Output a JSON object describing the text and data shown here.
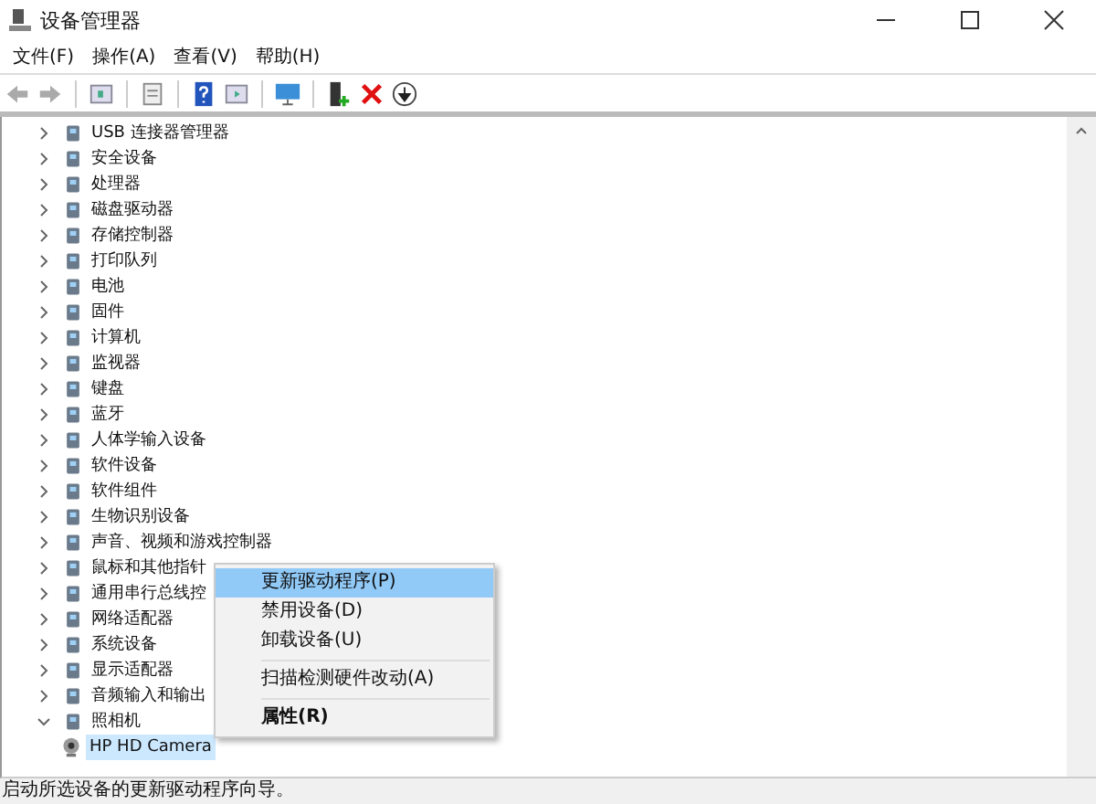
{
  "window": {
    "title": "设备管理器"
  },
  "menu": [
    "文件(F)",
    "操作(A)",
    "查看(V)",
    "帮助(H)"
  ],
  "tree": [
    {
      "label": "USB 连接器管理器",
      "expanded": false,
      "selected": false
    },
    {
      "label": "安全设备",
      "expanded": false,
      "selected": false
    },
    {
      "label": "处理器",
      "expanded": false,
      "selected": false
    },
    {
      "label": "磁盘驱动器",
      "expanded": false,
      "selected": false
    },
    {
      "label": "存储控制器",
      "expanded": false,
      "selected": false
    },
    {
      "label": "打印队列",
      "expanded": false,
      "selected": false
    },
    {
      "label": "电池",
      "expanded": false,
      "selected": false
    },
    {
      "label": "固件",
      "expanded": false,
      "selected": false
    },
    {
      "label": "计算机",
      "expanded": false,
      "selected": false
    },
    {
      "label": "监视器",
      "expanded": false,
      "selected": false
    },
    {
      "label": "键盘",
      "expanded": false,
      "selected": false
    },
    {
      "label": "蓝牙",
      "expanded": false,
      "selected": false
    },
    {
      "label": "人体学输入设备",
      "expanded": false,
      "selected": false
    },
    {
      "label": "软件设备",
      "expanded": false,
      "selected": false
    },
    {
      "label": "软件组件",
      "expanded": false,
      "selected": false
    },
    {
      "label": "生物识别设备",
      "expanded": false,
      "selected": false
    },
    {
      "label": "声音、视频和游戏控制器",
      "expanded": false,
      "selected": false
    },
    {
      "label": "鼠标和其他指针",
      "expanded": false,
      "selected": false
    },
    {
      "label": "通用串行总线控",
      "expanded": false,
      "selected": false
    },
    {
      "label": "网络适配器",
      "expanded": false,
      "selected": false
    },
    {
      "label": "系统设备",
      "expanded": false,
      "selected": false
    },
    {
      "label": "显示适配器",
      "expanded": false,
      "selected": false
    },
    {
      "label": "音频输入和输出",
      "expanded": false,
      "selected": false
    },
    {
      "label": "照相机",
      "expanded": true,
      "selected": false,
      "children": [
        {
          "label": "HP HD Camera",
          "selected": true
        }
      ]
    }
  ],
  "context_menu": [
    {
      "label": "更新驱动程序(P)",
      "selected": true,
      "bold": false
    },
    {
      "label": "禁用设备(D)",
      "selected": false,
      "bold": false
    },
    {
      "label": "卸载设备(U)",
      "selected": false,
      "bold": false,
      "separator_after": true
    },
    {
      "label": "扫描检测硬件改动(A)",
      "selected": false,
      "bold": false,
      "separator_after": true
    },
    {
      "label": "属性(R)",
      "selected": false,
      "bold": true
    }
  ],
  "status_bar": "启动所选设备的更新驱动程序向导。"
}
